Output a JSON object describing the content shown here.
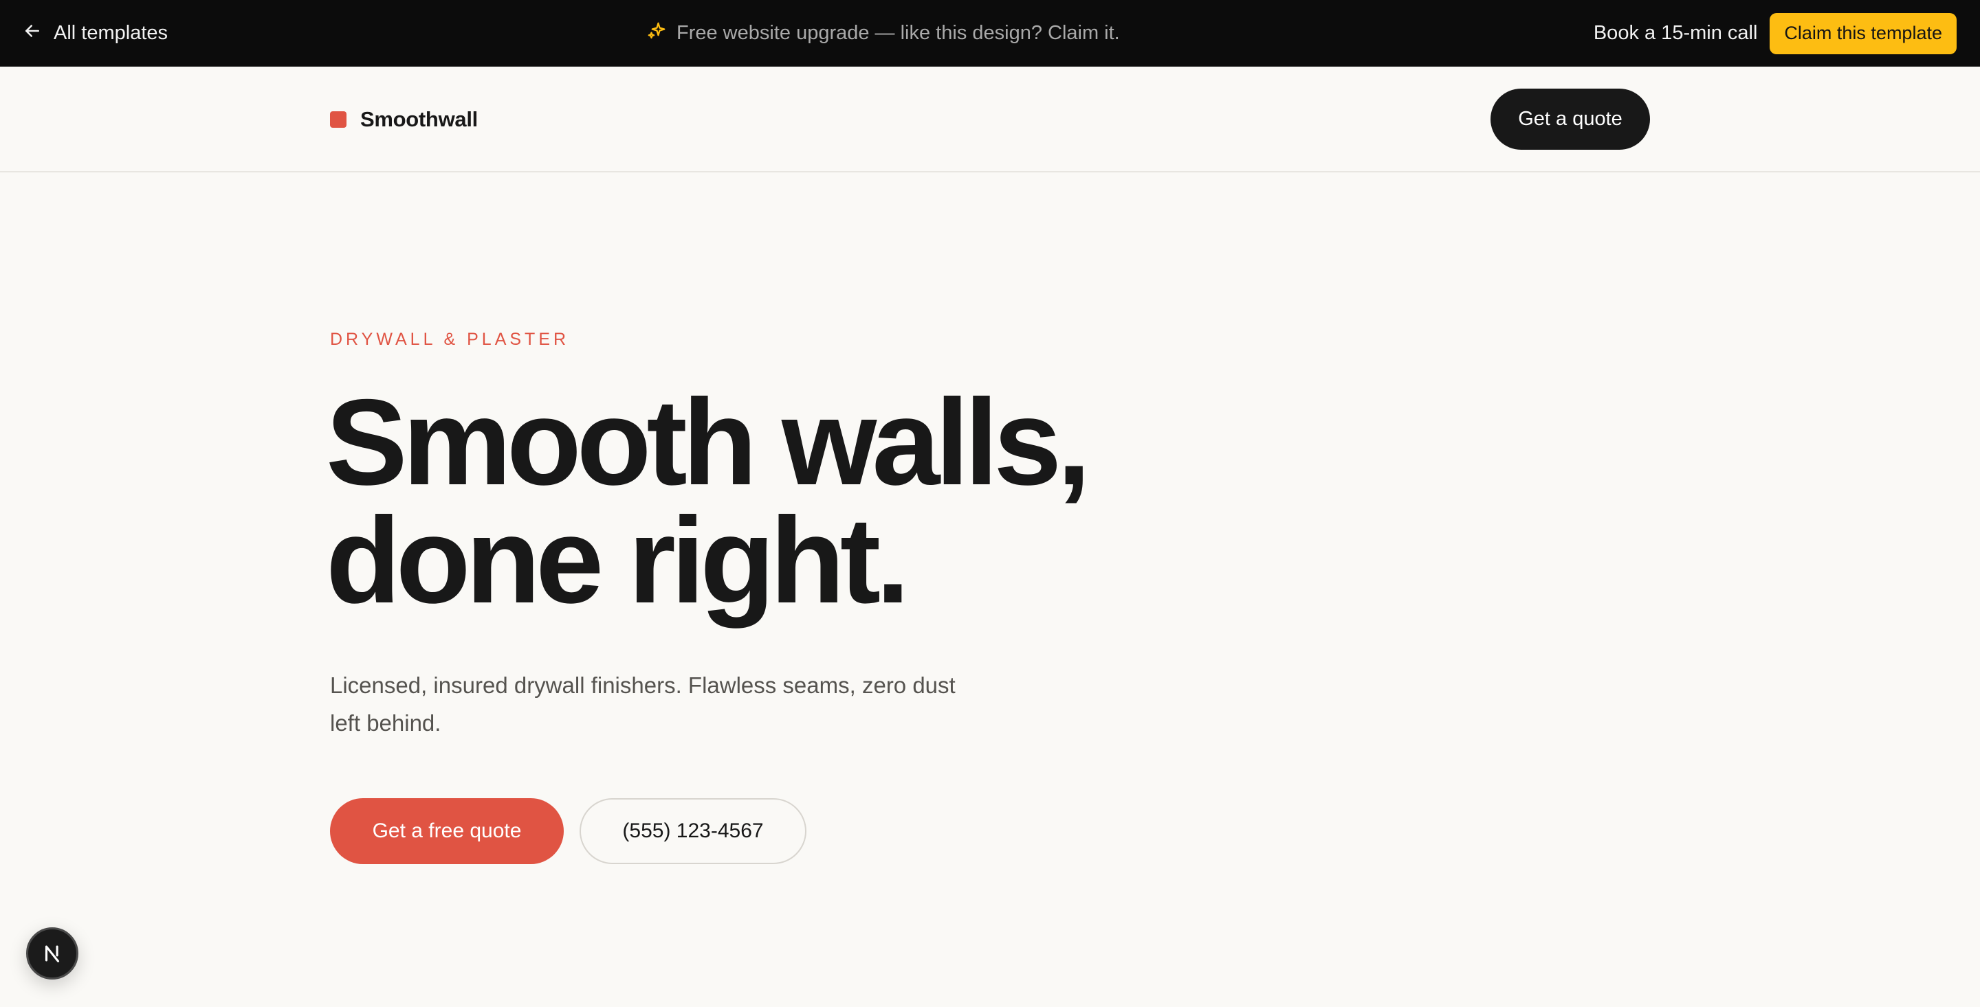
{
  "topbar": {
    "back_label": "All templates",
    "promo_text": "Free website upgrade — like this design? Claim it.",
    "book_call_label": "Book a 15-min call",
    "claim_label": "Claim this template",
    "accent_color": "#fdbd12"
  },
  "header": {
    "brand_name": "Smoothwall",
    "brand_color": "#e05443",
    "quote_label": "Get a quote"
  },
  "hero": {
    "eyebrow": "DRYWALL & PLASTER",
    "headline_line1": "Smooth walls,",
    "headline_line2": "done right.",
    "subtext": "Licensed, insured drywall finishers. Flawless seams, zero dust left behind.",
    "primary_cta": "Get a free quote",
    "phone_cta": "(555) 123-4567"
  },
  "icons": {
    "back": "arrow-left-icon",
    "promo": "sparkle-icon",
    "badge": "next-logo-icon"
  }
}
